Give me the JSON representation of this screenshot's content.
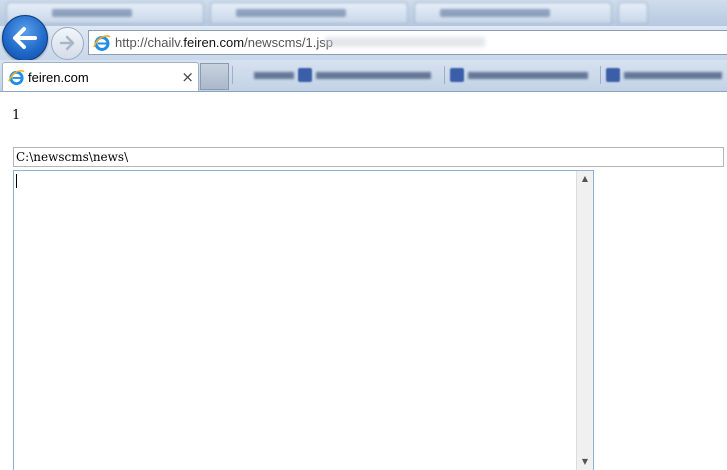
{
  "browser": {
    "address_url_prefix": "http://chailv.",
    "address_url_domain": "feiren.com",
    "address_url_path": "/newscms/1.jsp",
    "tab_title": "feiren.com",
    "tab_close_glyph": "×"
  },
  "page": {
    "count_text": "1",
    "path_input_value": "C:\\newscms\\news\\",
    "textarea_value": ""
  },
  "icons": {
    "back": "back-arrow-icon",
    "forward": "forward-arrow-icon",
    "site": "ie-icon"
  },
  "colors": {
    "back_button": "#1e66c8",
    "chrome_bg": "#c8d7ea",
    "textarea_border": "#8fb1cf"
  }
}
